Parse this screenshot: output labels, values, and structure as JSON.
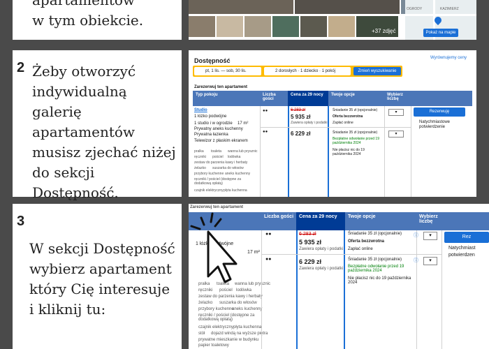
{
  "colors": {
    "booking_blue": "#1a6fd6",
    "header_blue": "#4b76b8",
    "dark_blue": "#003b95",
    "search_yellow": "#febb02"
  },
  "step1": {
    "text_lines": [
      "apartamentów",
      "w tym obiekcie."
    ],
    "photo_count": "+37 zdjęć",
    "map_button": "Pokaż na mapie",
    "map_labels": [
      "OGRODY",
      "KAZIMIERZ"
    ]
  },
  "step2": {
    "number": "2",
    "text_lines": [
      "Żeby otworzyć",
      "indywidualną galerię",
      "apartamentów",
      "musisz zjechać niżej",
      "do sekcji",
      "Dostępność."
    ],
    "widget": {
      "title": "Dostępność",
      "price_link": "Wyrównujemy ceny",
      "dates": "pt, 1 lis. — sob, 30 lis.",
      "guests": "2 dorosłych · 1 dziecko · 1 pokój",
      "search_button": "Zmień wyszukiwanie",
      "reserve_heading": "Zarezerwuj ten apartament",
      "headers": [
        "Typ pokoju",
        "Liczba gości",
        "Cena za 29 nocy",
        "Twoje opcje",
        "Wybierz liczbę"
      ],
      "room_name": "Studio",
      "bed": "1 łóżko podwójne",
      "features": [
        "1 studio i w ogrodzie",
        "17 m²",
        "Prywatny aneks kuchenny",
        "Prywatna łazienka",
        "Telewizor z płaskim ekranem"
      ],
      "amenities": [
        "pralka",
        "toaleta",
        "wanna lub prysznic",
        "ręczniki",
        "pościel",
        "lodówka",
        "zestaw do parzenia kawy i herbaty",
        "żelazko",
        "suszarka do włosów",
        "przybory kuchenne",
        "aneks kuchenny",
        "ręczniki / pościel (dostępne za dodatkową opłatą)",
        "czajnik elektryczny",
        "płyta kuchenna"
      ],
      "price_old": "6 283 zł",
      "price1": "5 935 zł",
      "price_note": "Zawiera opłaty i podatki",
      "price2": "6 229 zł",
      "option1": [
        "Śniadanie 35 zł (opcjonalnie)",
        "Oferta bezzwrotna",
        "Zapłać online"
      ],
      "option2": [
        "Śniadanie 35 zł (opcjonalnie)",
        "Bezpłatne odwołanie przed 19 października 2024",
        "Nie płacisz nic do 19 października 2024"
      ],
      "reserve_button": "Rezerwuję",
      "confirm_note": [
        "Natychmiastowe",
        "potwierdzenie"
      ]
    }
  },
  "step3": {
    "number": "3",
    "text_lines": [
      "W sekcji Dostępność",
      "wybierz apartament",
      "który Cię interesuje",
      "i kliknij tu:"
    ],
    "widget": {
      "reserve_heading": "Zarezerwuj ten apartament",
      "headers": [
        "Liczba gości",
        "Cena za 29 nocy",
        "Twoje opcje",
        "Wybierz liczbę"
      ],
      "bed": "1 łóżko podwójne",
      "area": "17 m²",
      "amenities": [
        "pralka",
        "toaleta",
        "wanna lub prysznic",
        "ręczniki",
        "pościel",
        "lodówka",
        "zestaw do parzenia kawy i herbaty",
        "żelazko",
        "suszarka do włosów",
        "przybory kuchenne",
        "aneks kuchenny",
        "ręczniki / pościel (dostępne za dodatkową opłatą)",
        "czajnik elektryczny",
        "płyta kuchenna",
        "stół",
        "dojazd windą na wyższe piętra",
        "prywatne mieszkanie w budynku",
        "papier toaletowy"
      ],
      "price_old": "6 283 zł",
      "price1": "5 935 zł",
      "price_note": "Zawiera opłaty i podatki",
      "price2": "6 229 zł",
      "option1": [
        "Śniadanie 35 zł (opcjonalnie)",
        "Oferta bezzwrotna",
        "Zapłać online"
      ],
      "option2": [
        "Śniadanie 35 zł (opcjonalnie)",
        "Bezpłatne odwołanie przed 19 października 2024",
        "Nie płacisz nic do 19 października 2024"
      ],
      "reserve_button": "Rez",
      "confirm_note": [
        "Natychmiast",
        "potwierdzen"
      ]
    }
  }
}
